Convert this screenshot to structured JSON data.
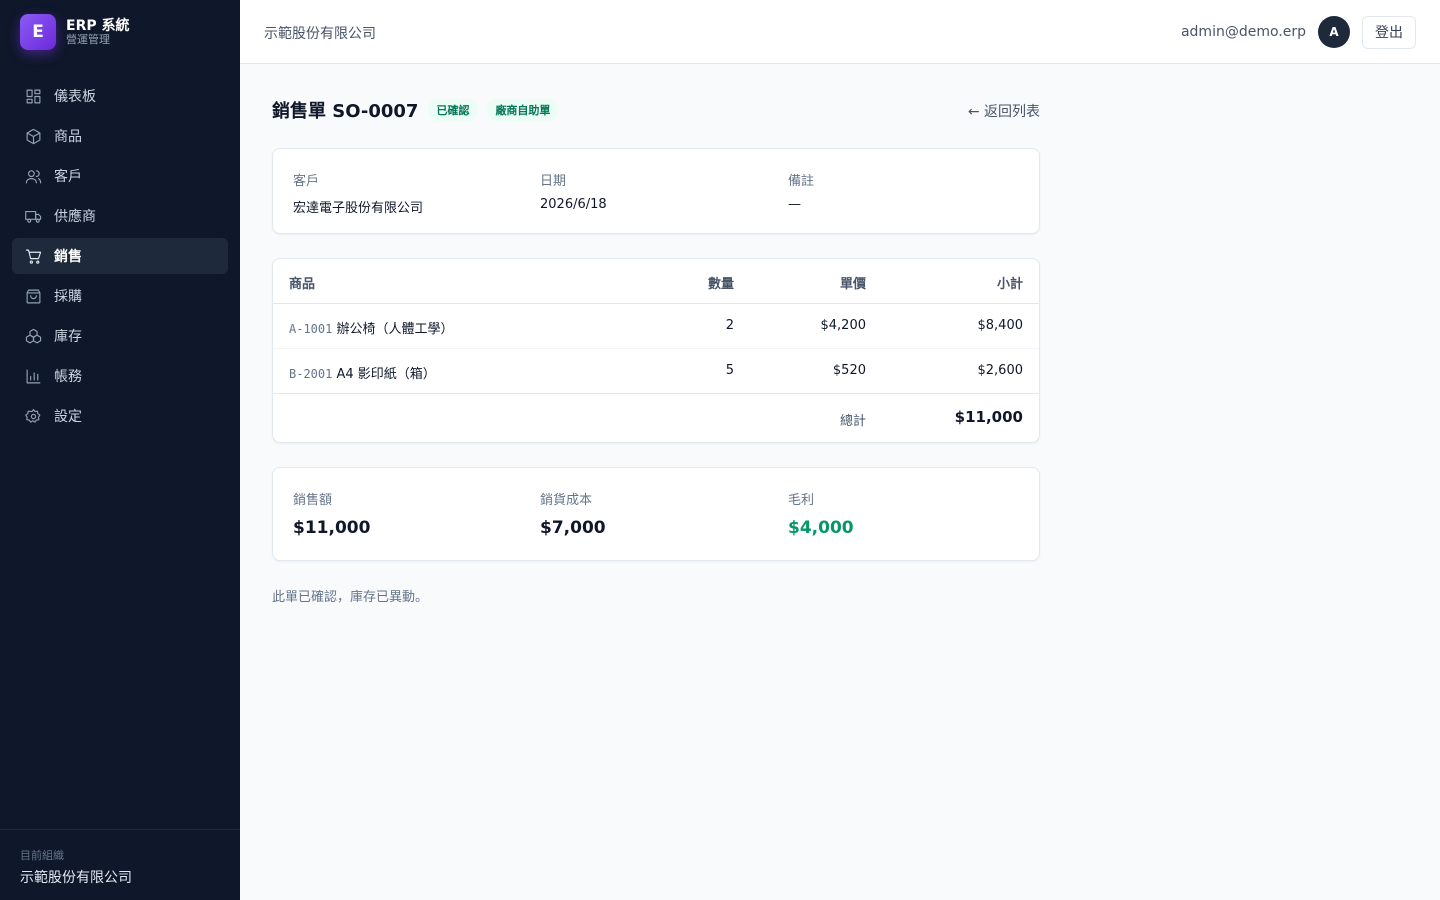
{
  "brand": {
    "logo_letter": "E",
    "title": "ERP 系統",
    "subtitle": "營運管理"
  },
  "nav": [
    {
      "label": "儀表板",
      "icon": "dashboard-icon",
      "active": false
    },
    {
      "label": "商品",
      "icon": "box-icon",
      "active": false
    },
    {
      "label": "客戶",
      "icon": "users-icon",
      "active": false
    },
    {
      "label": "供應商",
      "icon": "truck-icon",
      "active": false
    },
    {
      "label": "銷售",
      "icon": "cart-icon",
      "active": true
    },
    {
      "label": "採購",
      "icon": "shopping-bag-icon",
      "active": false
    },
    {
      "label": "庫存",
      "icon": "boxes-icon",
      "active": false
    },
    {
      "label": "帳務",
      "icon": "bar-chart-icon",
      "active": false
    },
    {
      "label": "設定",
      "icon": "gear-icon",
      "active": false
    }
  ],
  "sidebar_footer": {
    "label": "目前組織",
    "org_name": "示範股份有限公司"
  },
  "topbar": {
    "company": "示範股份有限公司",
    "email": "admin@demo.erp",
    "avatar_letter": "A",
    "logout_label": "登出"
  },
  "order": {
    "title": "銷售單 SO-0007",
    "badges": {
      "status": "已確認",
      "source": "廠商自助單"
    },
    "back_label": "← 返回列表",
    "info": {
      "customer_label": "客戶",
      "customer": "宏達電子股份有限公司",
      "date_label": "日期",
      "date": "2026/6/18",
      "note_label": "備註",
      "note": "—"
    },
    "table": {
      "headers": {
        "product": "商品",
        "qty": "數量",
        "price": "單價",
        "subtotal": "小計"
      },
      "rows": [
        {
          "sku": "A-1001",
          "name": "辦公椅（人體工學）",
          "qty": "2",
          "price": "$4,200",
          "subtotal": "$8,400"
        },
        {
          "sku": "B-2001",
          "name": "A4 影印紙（箱）",
          "qty": "5",
          "price": "$520",
          "subtotal": "$2,600"
        }
      ],
      "total_label": "總計",
      "total": "$11,000"
    },
    "stats": {
      "sales_label": "銷售額",
      "sales": "$11,000",
      "cost_label": "銷貨成本",
      "cost": "$7,000",
      "profit_label": "毛利",
      "profit": "$4,000"
    },
    "footer_note": "此單已確認，庫存已異動。"
  },
  "colors": {
    "sidebar_bg": "#0f172a",
    "brand_accent": "#7c3aed",
    "success": "#059669"
  }
}
